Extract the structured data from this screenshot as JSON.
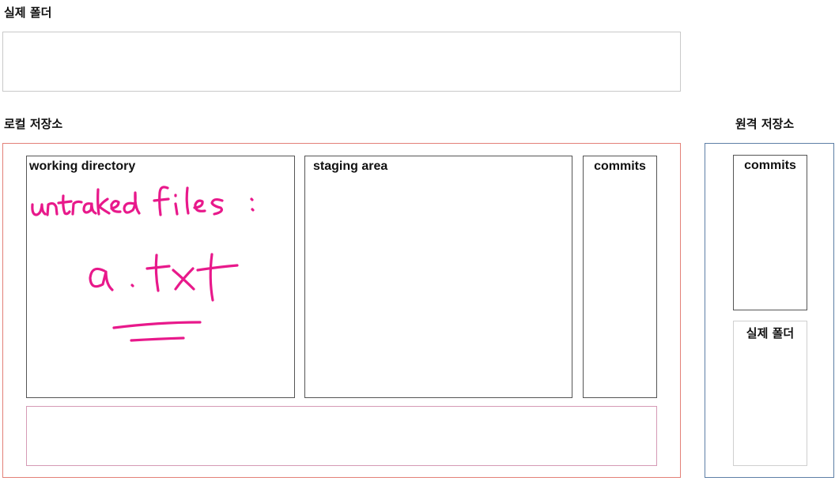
{
  "labels": {
    "real_folder": "실제 폴더",
    "local_repo": "로컬 저장소",
    "remote_repo": "원격 저장소"
  },
  "local": {
    "working_directory": "working directory",
    "staging_area": "staging area",
    "commits": "commits"
  },
  "remote": {
    "commits": "commits",
    "real_folder": "실제 폴더"
  },
  "annotation": {
    "line1": "untraked files:",
    "line2": "a.txt",
    "ink_color": "#e8198b"
  },
  "colors": {
    "local_border": "#e38078",
    "remote_border": "#5e7fa6",
    "bottom_border": "#d59ab5"
  }
}
